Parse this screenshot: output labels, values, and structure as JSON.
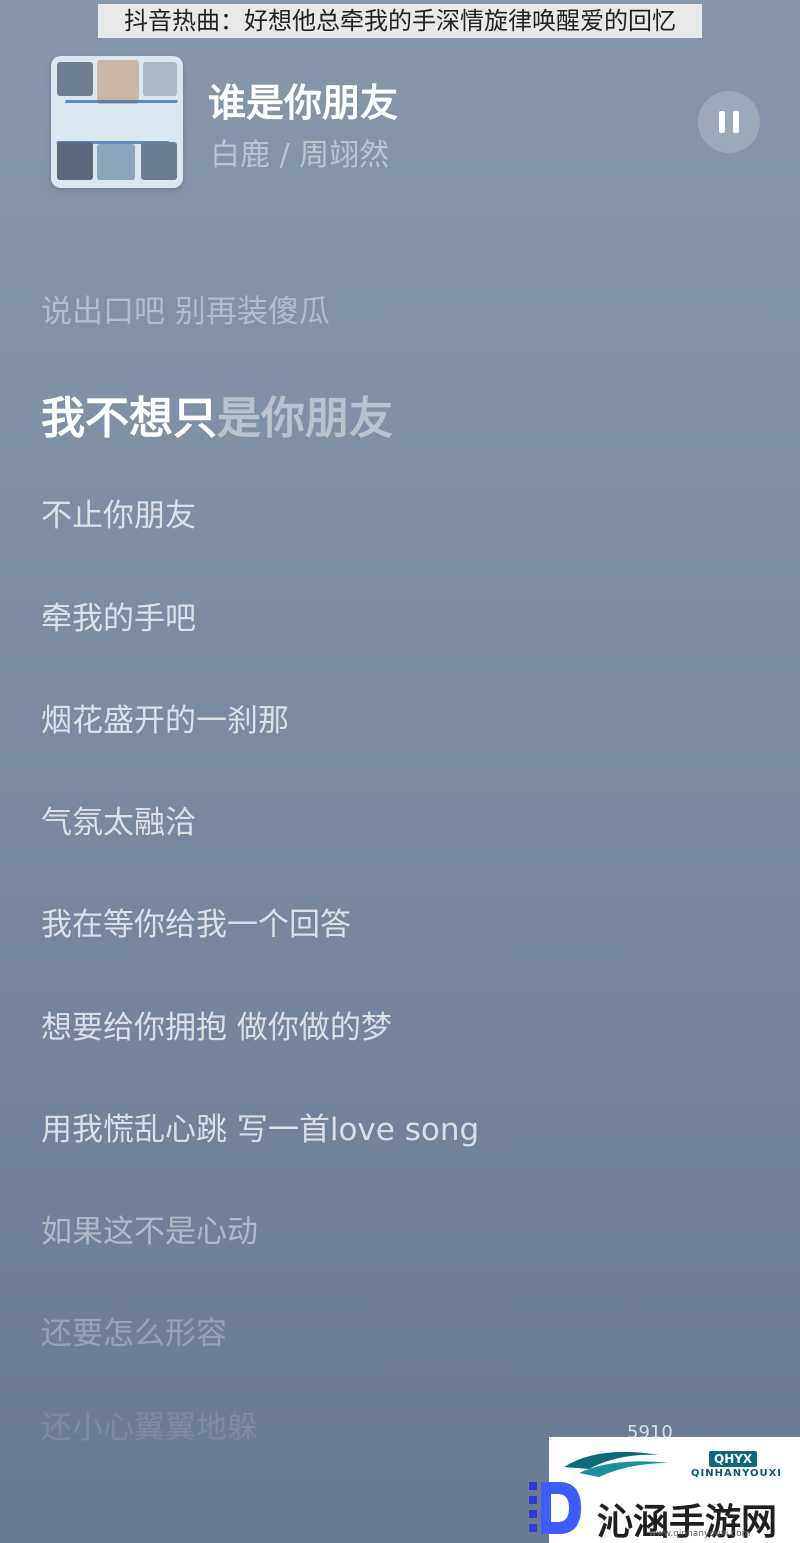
{
  "caption": "抖音热曲：好想他总牵我的手深情旋律唤醒爱的回忆",
  "now_playing": {
    "title": "谁是你朋友",
    "artist": "白鹿 / 周翊然"
  },
  "lyrics": {
    "line_prev": "说出口吧 别再装傻瓜",
    "current_sung": "我不想只",
    "current_unsung": "是你朋友",
    "line_1": "不止你朋友",
    "line_2": "牵我的手吧",
    "line_3": "烟花盛开的一刹那",
    "line_4": "气氛太融洽",
    "line_5": "我在等你给我一个回答",
    "line_6": "想要给你拥抱 做你做的梦",
    "line_7": "用我慌乱心跳 写一首love song",
    "line_8": "如果这不是心动",
    "line_9": "还要怎么形容",
    "line_10": "还小心翼翼地躲"
  },
  "count_label": "5910",
  "watermark": {
    "badge": "QHYX",
    "sub": "QINHANYOUXI",
    "main": "沁涵手游网",
    "url": "www.qinhanyouxi.com"
  },
  "colors": {
    "bg_top": "#8796a9",
    "bg_bottom": "#6a7a92",
    "accent_logo": "#0c6a7a"
  }
}
